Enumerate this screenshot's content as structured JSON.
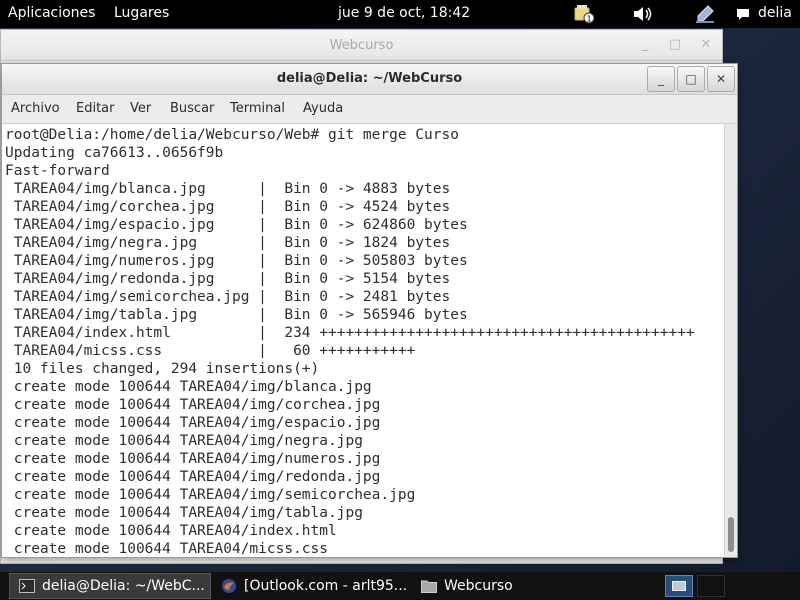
{
  "topbar": {
    "applications": "Aplicaciones",
    "places": "Lugares",
    "clock": "jue  9 de oct, 18:42",
    "notification_count": "1",
    "user": "delia"
  },
  "back_window": {
    "title": "Webcurso",
    "minimize": "_",
    "maximize": "□",
    "close": "✕"
  },
  "terminal_window": {
    "title": "delia@Delia: ~/WebCurso",
    "minimize": "_",
    "maximize": "□",
    "close": "✕",
    "menu": [
      "Archivo",
      "Editar",
      "Ver",
      "Buscar",
      "Terminal",
      "Ayuda"
    ],
    "output": [
      "root@Delia:/home/delia/Webcurso/Web# git merge Curso",
      "Updating ca76613..0656f9b",
      "Fast-forward",
      " TAREA04/img/blanca.jpg      |  Bin 0 -> 4883 bytes",
      " TAREA04/img/corchea.jpg     |  Bin 0 -> 4524 bytes",
      " TAREA04/img/espacio.jpg     |  Bin 0 -> 624860 bytes",
      " TAREA04/img/negra.jpg       |  Bin 0 -> 1824 bytes",
      " TAREA04/img/numeros.jpg     |  Bin 0 -> 505803 bytes",
      " TAREA04/img/redonda.jpg     |  Bin 0 -> 5154 bytes",
      " TAREA04/img/semicorchea.jpg |  Bin 0 -> 2481 bytes",
      " TAREA04/img/tabla.jpg       |  Bin 0 -> 565946 bytes",
      " TAREA04/index.html          |  234 +++++++++++++++++++++++++++++++++++++++++++",
      " TAREA04/micss.css           |   60 +++++++++++",
      " 10 files changed, 294 insertions(+)",
      " create mode 100644 TAREA04/img/blanca.jpg",
      " create mode 100644 TAREA04/img/corchea.jpg",
      " create mode 100644 TAREA04/img/espacio.jpg",
      " create mode 100644 TAREA04/img/negra.jpg",
      " create mode 100644 TAREA04/img/numeros.jpg",
      " create mode 100644 TAREA04/img/redonda.jpg",
      " create mode 100644 TAREA04/img/semicorchea.jpg",
      " create mode 100644 TAREA04/img/tabla.jpg",
      " create mode 100644 TAREA04/index.html",
      " create mode 100644 TAREA04/micss.css"
    ]
  },
  "taskbar": {
    "tasks": [
      {
        "label": "delia@Delia: ~/WebC...",
        "icon": "terminal-icon",
        "active": true
      },
      {
        "label": "[Outlook.com - arlt95...",
        "icon": "browser-icon",
        "active": false
      },
      {
        "label": "Webcurso",
        "icon": "folder-icon",
        "active": false
      }
    ]
  },
  "colors": {
    "topbar_bg": "#000000",
    "taskbar_bg": "#111111",
    "active_task_bg": "#3a3a3a",
    "terminal_bg": "#ffffff",
    "terminal_fg": "#2e2e2e",
    "workspace_active": "#274d7a"
  }
}
